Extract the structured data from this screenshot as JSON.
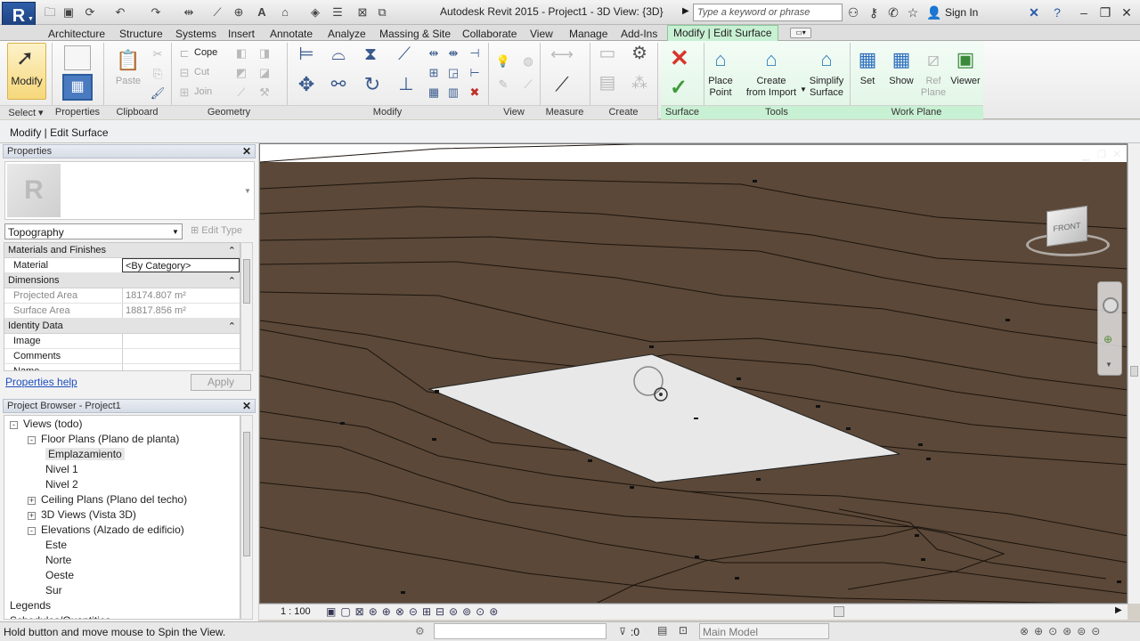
{
  "titlebar": {
    "logo": "R",
    "app_title": "Autodesk Revit 2015 -    Project1 - 3D View: {3D}",
    "search_placeholder": "Type a keyword or phrase",
    "sign_in": "Sign In",
    "icons": [
      "open-icon",
      "save-icon",
      "sync-icon",
      "undo-icon",
      "redo-icon",
      "measure-icon",
      "align-icon",
      "text-icon",
      "3d-view-icon",
      "section-icon",
      "thin-lines-icon",
      "close-hidden-icon",
      "switch-windows-icon",
      "binoculars-icon",
      "help-icon",
      "star-icon",
      "user-icon",
      "exchange-icon",
      "help-icon"
    ]
  },
  "tabs": [
    "Architecture",
    "Structure",
    "Systems",
    "Insert",
    "Annotate",
    "Analyze",
    "Massing & Site",
    "Collaborate",
    "View",
    "Manage",
    "Add-Ins",
    "Modify | Edit Surface"
  ],
  "ribbon": {
    "select": {
      "modify_label": "Modify",
      "panel": "Select"
    },
    "properties": {
      "panel": "Properties"
    },
    "clipboard": {
      "paste_label": "Paste",
      "panel": "Clipboard"
    },
    "geometry": {
      "cope_label": "Cope",
      "cut_label": "Cut",
      "join_label": "Join",
      "panel": "Geometry"
    },
    "modify": {
      "panel": "Modify"
    },
    "view": {
      "panel": "View"
    },
    "measure": {
      "panel": "Measure"
    },
    "create": {
      "panel": "Create"
    },
    "surface": {
      "panel": "Surface"
    },
    "tools": {
      "place_point": "Place\nPoint",
      "create_from_import": "Create\nfrom Import",
      "simplify_surface": "Simplify\nSurface",
      "panel": "Tools"
    },
    "work_plane": {
      "set": "Set",
      "show": "Show",
      "ref_plane": "Ref\nPlane",
      "viewer": "Viewer",
      "panel": "Work Plane"
    }
  },
  "optionsbar": {
    "label": "Modify | Edit Surface"
  },
  "properties": {
    "title": "Properties",
    "type_selector": "Topography",
    "edit_type": "Edit Type",
    "sections": [
      {
        "name": "Materials and Finishes",
        "rows": [
          {
            "k": "Material",
            "v": "<By Category>"
          }
        ]
      },
      {
        "name": "Dimensions",
        "rows": [
          {
            "k": "Projected Area",
            "v": "18174.807 m²"
          },
          {
            "k": "Surface Area",
            "v": "18817.856 m²"
          }
        ]
      },
      {
        "name": "Identity Data",
        "rows": [
          {
            "k": "Image",
            "v": ""
          },
          {
            "k": "Comments",
            "v": ""
          },
          {
            "k": "Name",
            "v": ""
          }
        ]
      }
    ],
    "help_link": "Properties help",
    "apply": "Apply"
  },
  "browser": {
    "title": "Project Browser - Project1",
    "items": [
      {
        "label": "Views (todo)",
        "level": 0,
        "exp": "-"
      },
      {
        "label": "Floor Plans (Plano de planta)",
        "level": 1,
        "exp": "-"
      },
      {
        "label": "Emplazamiento",
        "level": 2,
        "exp": ""
      },
      {
        "label": "Nivel 1",
        "level": 2,
        "exp": ""
      },
      {
        "label": "Nivel 2",
        "level": 2,
        "exp": ""
      },
      {
        "label": "Ceiling Plans (Plano del techo)",
        "level": 1,
        "exp": "+"
      },
      {
        "label": "3D Views (Vista 3D)",
        "level": 1,
        "exp": "+"
      },
      {
        "label": "Elevations (Alzado de edificio)",
        "level": 1,
        "exp": "-"
      },
      {
        "label": "Este",
        "level": 2,
        "exp": ""
      },
      {
        "label": "Norte",
        "level": 2,
        "exp": ""
      },
      {
        "label": "Oeste",
        "level": 2,
        "exp": ""
      },
      {
        "label": "Sur",
        "level": 2,
        "exp": ""
      },
      {
        "label": "Legends",
        "level": 0,
        "exp": ""
      },
      {
        "label": "Schedules/Quantities",
        "level": 0,
        "exp": ""
      }
    ]
  },
  "viewport": {
    "viewcube_face": "FRONT",
    "scale": "1 : 100"
  },
  "statusbar": {
    "message": "Hold button and move mouse to Spin the View.",
    "selection_count": ":0",
    "model": "Main Model"
  },
  "colors": {
    "ribbon_context": "#c8f0d3",
    "terrain": "#5a4738",
    "pad": "#e6e6e6"
  }
}
